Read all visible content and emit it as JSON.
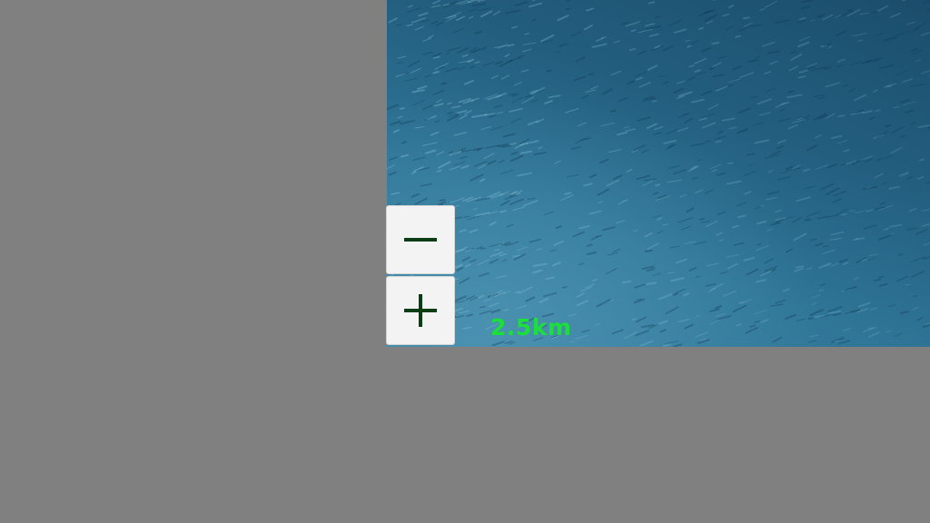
{
  "map": {
    "scale_text": "2.5km",
    "water_colors": {
      "deep": "#1b4d6b",
      "mid": "#2f7596",
      "light": "#3a82a3"
    },
    "background_color": "#808080"
  },
  "controls": {
    "zoom_out": {
      "symbol": "−",
      "icon": "minus-icon"
    },
    "zoom_in": {
      "symbol": "+",
      "icon": "plus-icon"
    },
    "icon_color": "#0b3d14",
    "button_color": "#f3f3f3"
  },
  "scale_color": "#1be03a"
}
